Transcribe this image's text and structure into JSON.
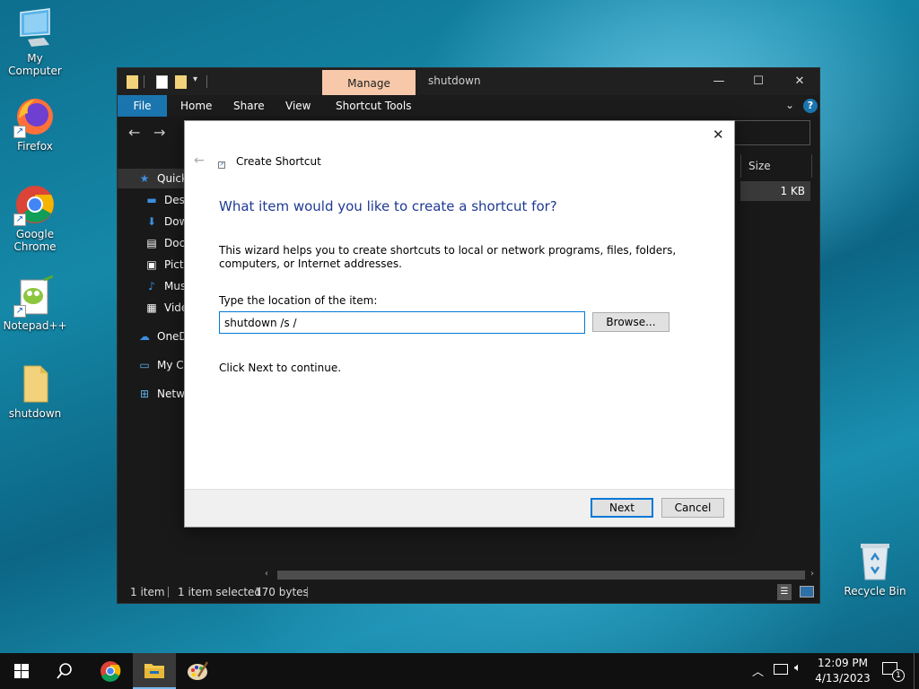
{
  "desktop": {
    "icons": [
      {
        "label": "My Computer",
        "icon": "computer-icon"
      },
      {
        "label": "Firefox",
        "icon": "firefox-icon"
      },
      {
        "label": "Google Chrome",
        "icon": "chrome-icon"
      },
      {
        "label": "Notepad++",
        "icon": "notepadpp-icon"
      },
      {
        "label": "shutdown",
        "icon": "file-icon"
      },
      {
        "label": "Recycle Bin",
        "icon": "recycle-bin-icon"
      }
    ]
  },
  "explorer": {
    "manage_tab": "Manage",
    "title": "shutdown",
    "ribbon_tabs": [
      "File",
      "Home",
      "Share",
      "View",
      "Shortcut Tools"
    ],
    "column_size": "Size",
    "row_size": "1 KB",
    "sidebar": [
      "Quick",
      "Desk",
      "Dow",
      "Doc",
      "Pictu",
      "Mus",
      "Vide",
      "OneD",
      "My Co",
      "Netwo"
    ],
    "status": {
      "items": "1 item",
      "selected": "1 item selected",
      "size": "170 bytes"
    }
  },
  "dialog": {
    "title": "Create Shortcut",
    "heading": "What item would you like to create a shortcut for?",
    "description": "This wizard helps you to create shortcuts to local or network programs, files, folders, computers, or Internet addresses.",
    "location_label": "Type the location of the item:",
    "location_value": "shutdown /s /",
    "browse_label": "Browse...",
    "instruction": "Click Next to continue.",
    "next_label": "Next",
    "cancel_label": "Cancel"
  },
  "taskbar": {
    "time": "12:09 PM",
    "date": "4/13/2023",
    "notification_count": "1"
  },
  "colors": {
    "accent": "#0078d7",
    "heading": "#1f3a93",
    "manage_tab": "#f7c9aa",
    "file_tab": "#1a75ae"
  }
}
